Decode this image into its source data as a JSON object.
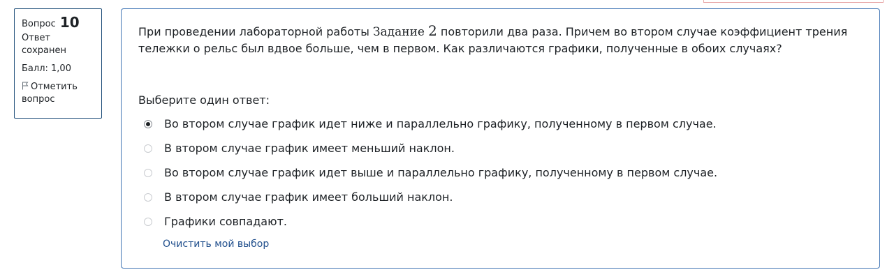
{
  "info": {
    "question_word": "Вопрос",
    "question_number": "10",
    "state": "Ответ сохранен",
    "grade": "Балл: 1,00",
    "flag_label": "Отметить вопрос"
  },
  "question": {
    "text_before": "При проведении лабораторной работы ",
    "text_inline_word": "Задание",
    "text_inline_number": "2",
    "text_after": " повторили два раза. Причем во втором случае коэффициент трения тележки о рельс был вдвое больше, чем в первом. Как различаются графики, полученные в обоих случаях?",
    "prompt": "Выберите один ответ:",
    "options": [
      {
        "label": "Во втором случае график идет ниже и параллельно графику, полученному в первом случае.",
        "selected": true
      },
      {
        "label": "В втором случае график имеет меньший наклон.",
        "selected": false
      },
      {
        "label": "Во втором случае график идет выше и параллельно графику, полученному в первом случае.",
        "selected": false
      },
      {
        "label": "В втором случае график имеет больший наклон.",
        "selected": false
      },
      {
        "label": "Графики совпадают.",
        "selected": false
      }
    ],
    "clear_label": "Очистить мой выбор"
  },
  "colors": {
    "border_info": "#1f4e79",
    "border_question": "#3f74b4",
    "link": "#1f4e8c"
  }
}
